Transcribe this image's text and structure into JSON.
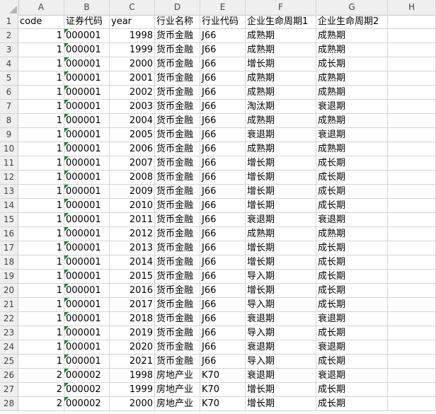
{
  "columns": [
    "A",
    "B",
    "C",
    "D",
    "E",
    "F",
    "G",
    "H"
  ],
  "rows": [
    {
      "n": "1",
      "c": [
        "code",
        "证券代码",
        "year",
        "行业名称",
        "行业代码",
        "企业生命周期1",
        "企业生命周期2",
        ""
      ]
    },
    {
      "n": "2",
      "c": [
        "1",
        "000001",
        "1998",
        "货币金融",
        "J66",
        "成熟期",
        "成熟期",
        ""
      ]
    },
    {
      "n": "3",
      "c": [
        "1",
        "000001",
        "1999",
        "货币金融",
        "J66",
        "成熟期",
        "成熟期",
        ""
      ]
    },
    {
      "n": "4",
      "c": [
        "1",
        "000001",
        "2000",
        "货币金融",
        "J66",
        "增长期",
        "成长期",
        ""
      ]
    },
    {
      "n": "5",
      "c": [
        "1",
        "000001",
        "2001",
        "货币金融",
        "J66",
        "成熟期",
        "成熟期",
        ""
      ]
    },
    {
      "n": "6",
      "c": [
        "1",
        "000001",
        "2002",
        "货币金融",
        "J66",
        "成熟期",
        "成熟期",
        ""
      ]
    },
    {
      "n": "7",
      "c": [
        "1",
        "000001",
        "2003",
        "货币金融",
        "J66",
        "淘汰期",
        "衰退期",
        ""
      ]
    },
    {
      "n": "8",
      "c": [
        "1",
        "000001",
        "2004",
        "货币金融",
        "J66",
        "成熟期",
        "成熟期",
        ""
      ]
    },
    {
      "n": "9",
      "c": [
        "1",
        "000001",
        "2005",
        "货币金融",
        "J66",
        "衰退期",
        "衰退期",
        ""
      ]
    },
    {
      "n": "10",
      "c": [
        "1",
        "000001",
        "2006",
        "货币金融",
        "J66",
        "成熟期",
        "成熟期",
        ""
      ]
    },
    {
      "n": "11",
      "c": [
        "1",
        "000001",
        "2007",
        "货币金融",
        "J66",
        "增长期",
        "成长期",
        ""
      ]
    },
    {
      "n": "12",
      "c": [
        "1",
        "000001",
        "2008",
        "货币金融",
        "J66",
        "增长期",
        "成长期",
        ""
      ]
    },
    {
      "n": "13",
      "c": [
        "1",
        "000001",
        "2009",
        "货币金融",
        "J66",
        "增长期",
        "成长期",
        ""
      ]
    },
    {
      "n": "14",
      "c": [
        "1",
        "000001",
        "2010",
        "货币金融",
        "J66",
        "增长期",
        "成长期",
        ""
      ]
    },
    {
      "n": "15",
      "c": [
        "1",
        "000001",
        "2011",
        "货币金融",
        "J66",
        "衰退期",
        "衰退期",
        ""
      ]
    },
    {
      "n": "16",
      "c": [
        "1",
        "000001",
        "2012",
        "货币金融",
        "J66",
        "成熟期",
        "成熟期",
        ""
      ]
    },
    {
      "n": "17",
      "c": [
        "1",
        "000001",
        "2013",
        "货币金融",
        "J66",
        "增长期",
        "成长期",
        ""
      ]
    },
    {
      "n": "18",
      "c": [
        "1",
        "000001",
        "2014",
        "货币金融",
        "J66",
        "增长期",
        "成长期",
        ""
      ]
    },
    {
      "n": "19",
      "c": [
        "1",
        "000001",
        "2015",
        "货币金融",
        "J66",
        "导入期",
        "成长期",
        ""
      ]
    },
    {
      "n": "20",
      "c": [
        "1",
        "000001",
        "2016",
        "货币金融",
        "J66",
        "增长期",
        "成长期",
        ""
      ]
    },
    {
      "n": "21",
      "c": [
        "1",
        "000001",
        "2017",
        "货币金融",
        "J66",
        "导入期",
        "成长期",
        ""
      ]
    },
    {
      "n": "22",
      "c": [
        "1",
        "000001",
        "2018",
        "货币金融",
        "J66",
        "衰退期",
        "衰退期",
        ""
      ]
    },
    {
      "n": "23",
      "c": [
        "1",
        "000001",
        "2019",
        "货币金融",
        "J66",
        "导入期",
        "成长期",
        ""
      ]
    },
    {
      "n": "24",
      "c": [
        "1",
        "000001",
        "2020",
        "货币金融",
        "J66",
        "衰退期",
        "衰退期",
        ""
      ]
    },
    {
      "n": "25",
      "c": [
        "1",
        "000001",
        "2021",
        "货币金融",
        "J66",
        "导入期",
        "成长期",
        ""
      ]
    },
    {
      "n": "26",
      "c": [
        "2",
        "000002",
        "1998",
        "房地产业",
        "K70",
        "衰退期",
        "衰退期",
        ""
      ]
    },
    {
      "n": "27",
      "c": [
        "2",
        "000002",
        "1999",
        "房地产业",
        "K70",
        "增长期",
        "成长期",
        ""
      ]
    },
    {
      "n": "28",
      "c": [
        "2",
        "000002",
        "2000",
        "房地产业",
        "K70",
        "增长期",
        "成长期",
        ""
      ]
    }
  ]
}
